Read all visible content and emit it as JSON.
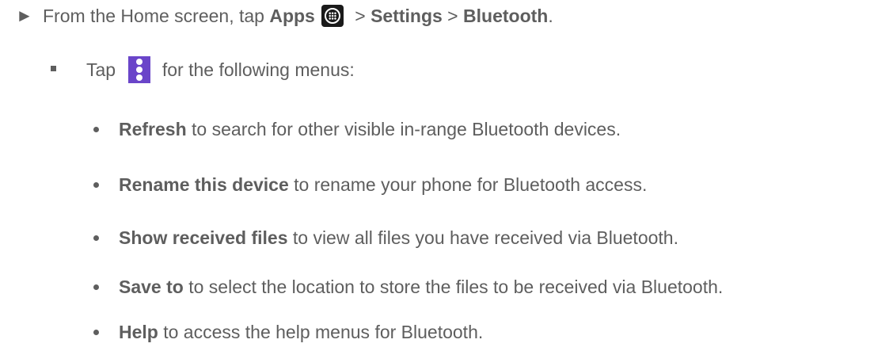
{
  "step": {
    "marker": "►",
    "prefix": "From the Home screen, tap ",
    "apps_label": "Apps",
    "apps_icon": "apps-grid-icon",
    "sep1": " > ",
    "settings_label": "Settings",
    "sep2": " > ",
    "bluetooth_label": "Bluetooth",
    "suffix": "."
  },
  "sub_step": {
    "prefix": "Tap ",
    "menu_icon": "more-options-icon",
    "menu_icon_color": "#6a45c9",
    "suffix": " for the following menus:"
  },
  "menu_items": [
    {
      "term": "Refresh",
      "desc": " to search for other visible in-range Bluetooth devices."
    },
    {
      "term": "Rename this device",
      "desc": " to rename your phone for Bluetooth access."
    },
    {
      "term": "Show received files",
      "desc": " to view all files you have received via Bluetooth."
    },
    {
      "term": "Save to",
      "desc": " to select the location to store the files to be received via Bluetooth."
    },
    {
      "term": "Help",
      "desc": " to access the help menus for Bluetooth."
    }
  ]
}
